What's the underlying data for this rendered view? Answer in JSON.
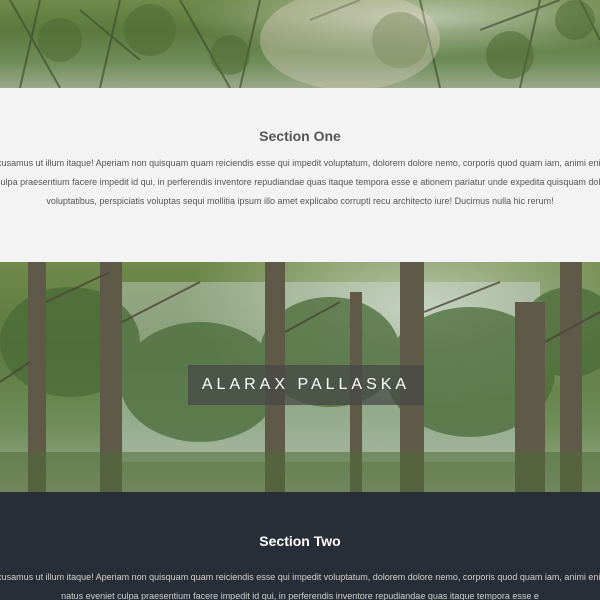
{
  "section_one": {
    "title": "Section One",
    "body": "icing elit. Accusamus ut illum itaque! Aperiam non quisquam quam reiciendis esse qui impedit voluptatum, dolorem dolore nemo, corporis quod quam iam, animi enim dolor fuga natus eveniet culpa praesentium facere impedit id qui, in perferendis inventore repudiandae quas itaque tempora esse e ationem pariatur unde expedita quisquam doloribus laborum voluptatibus, perspiciatis voluptas sequi mollitia ipsum illo amet explicabo corrupti recu architecto iure! Ducimus nulla hic rerum!"
  },
  "banner": {
    "text": "ALARAX PALLASKA"
  },
  "section_two": {
    "title": "Section Two",
    "body": "icing elit. Accusamus ut illum itaque! Aperiam non quisquam quam reiciendis esse qui impedit voluptatum, dolorem dolore nemo, corporis quod quam iam, animi enim dolor fuga natus eveniet culpa praesentium facere impedit id qui, in perferendis inventore repudiandae quas itaque tempora esse e"
  },
  "colors": {
    "section_one_bg": "#f3f3f3",
    "section_two_bg": "#282e38",
    "banner_bg": "#464646"
  }
}
